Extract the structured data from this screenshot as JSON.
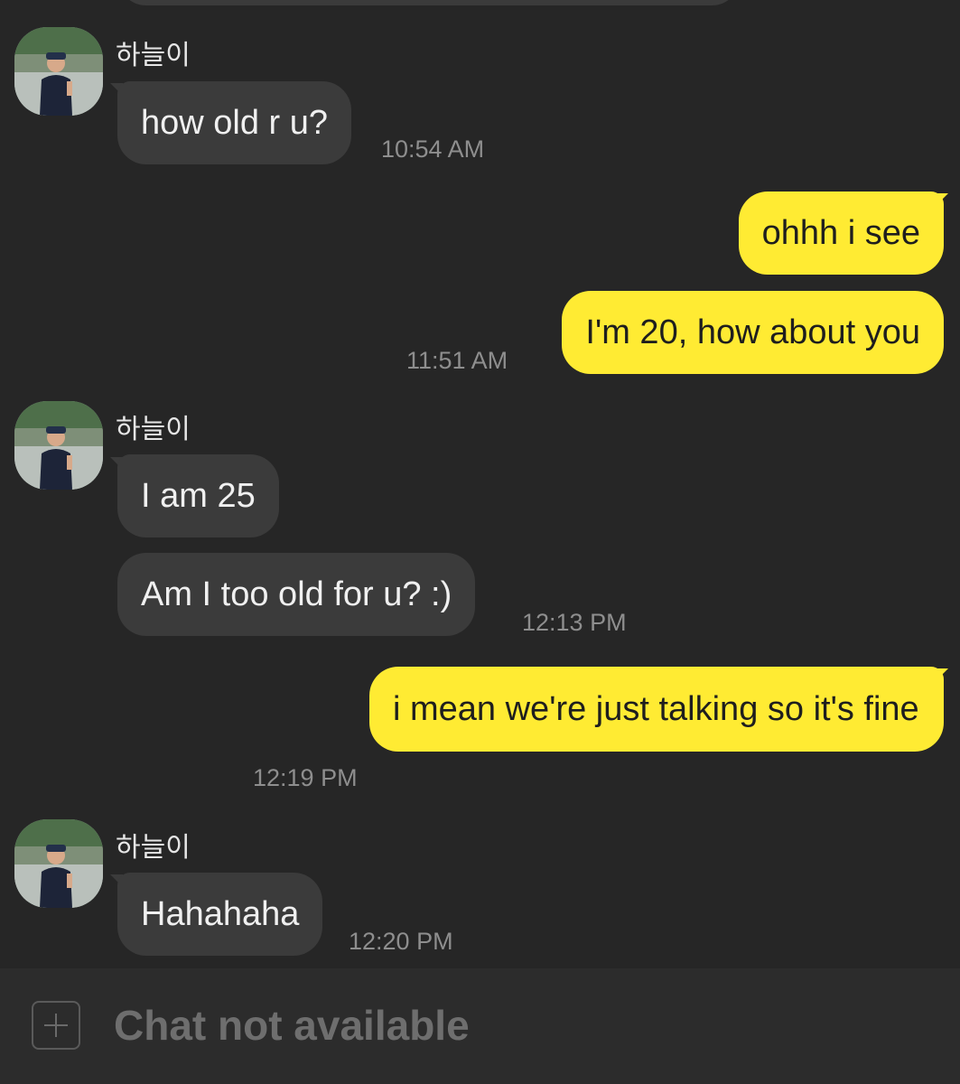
{
  "chat": {
    "messages": [
      {
        "sender": "하늘이",
        "text": "how old r u?",
        "time": "10:54 AM"
      },
      {
        "text": "ohhh i see"
      },
      {
        "text": "I'm 20, how about you",
        "time": "11:51 AM"
      },
      {
        "sender": "하늘이",
        "text": "I am 25"
      },
      {
        "text": "Am I too old for u? :)",
        "time": "12:13 PM"
      },
      {
        "text": "i mean we're just talking so it's fine",
        "time": "12:19 PM"
      },
      {
        "sender": "하늘이",
        "text": "Hahahaha",
        "time": "12:20 PM"
      }
    ],
    "colors": {
      "background": "#262626",
      "incoming_bubble": "#3b3b3b",
      "outgoing_bubble": "#ffeb33",
      "timestamp": "#8e8e8e"
    }
  },
  "input_bar": {
    "placeholder": "Chat not available",
    "attach_icon": "plus-square-icon"
  }
}
